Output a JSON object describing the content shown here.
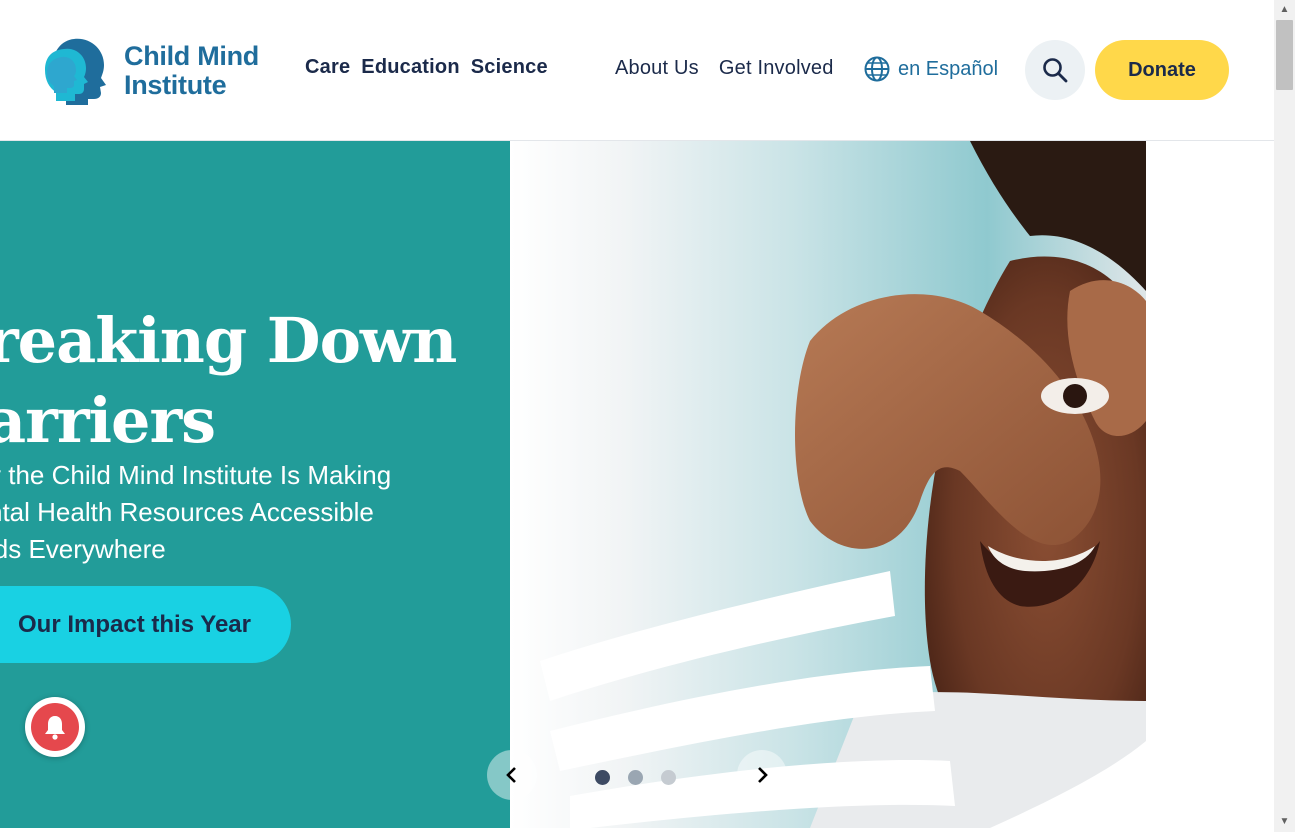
{
  "header": {
    "logo": {
      "line1": "Child Mind",
      "line2": "Institute"
    },
    "primary_nav": [
      {
        "label": "Care"
      },
      {
        "label": "Education"
      },
      {
        "label": "Science"
      }
    ],
    "secondary_nav": [
      {
        "label": "About Us"
      },
      {
        "label": "Get Involved"
      }
    ],
    "language": {
      "label": "en Español",
      "icon": "globe-icon"
    },
    "search": {
      "icon": "search-icon"
    },
    "donate_label": "Donate"
  },
  "hero": {
    "title_line1": "reaking Down",
    "title_line2": "arriers",
    "sub_line1": "v the Child Mind Institute Is Making",
    "sub_line2": "ntal Health Resources Accessible",
    "sub_line3": "ids Everywhere",
    "cta_label": "Our Impact this Year",
    "carousel": {
      "slide_count": 3,
      "active_index": 0
    }
  },
  "colors": {
    "teal": "#229c99",
    "cta_cyan": "#19d1e3",
    "donate_yellow": "#ffd84a",
    "brand_blue": "#1f6d9c",
    "navy": "#1b2a4a",
    "notify_red": "#e5484d"
  }
}
